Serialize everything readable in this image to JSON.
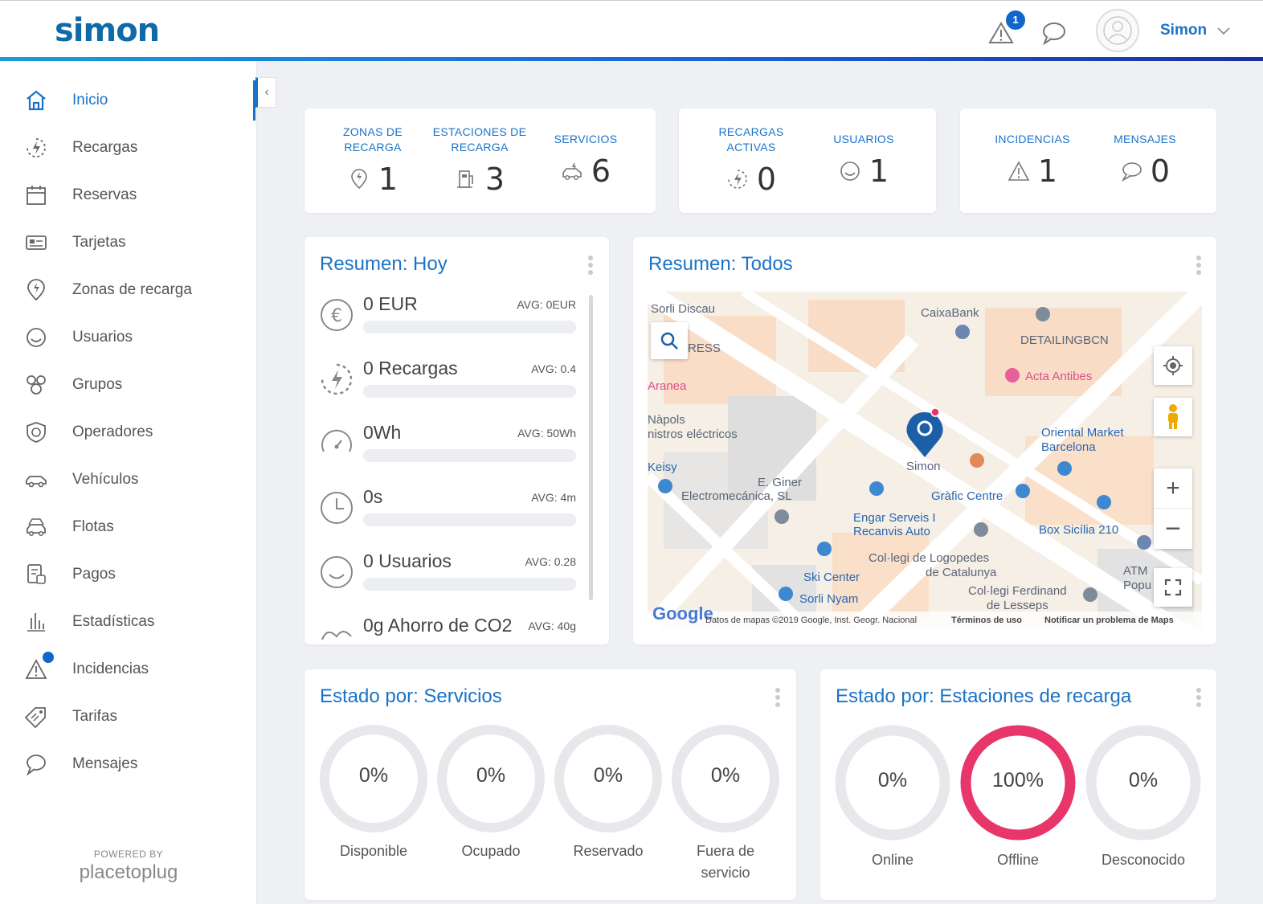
{
  "header": {
    "logo": "simon",
    "alert_count": "1",
    "user_name": "Simon"
  },
  "sidebar": {
    "items": [
      {
        "label": "Inicio",
        "icon": "home-icon",
        "active": true
      },
      {
        "label": "Recargas",
        "icon": "charge-icon"
      },
      {
        "label": "Reservas",
        "icon": "calendar-icon"
      },
      {
        "label": "Tarjetas",
        "icon": "card-icon"
      },
      {
        "label": "Zonas de recarga",
        "icon": "charge-zone-icon"
      },
      {
        "label": "Usuarios",
        "icon": "user-smile-icon"
      },
      {
        "label": "Grupos",
        "icon": "groups-icon"
      },
      {
        "label": "Operadores",
        "icon": "shield-icon"
      },
      {
        "label": "Vehículos",
        "icon": "car-icon"
      },
      {
        "label": "Flotas",
        "icon": "fleet-icon"
      },
      {
        "label": "Pagos",
        "icon": "payments-icon"
      },
      {
        "label": "Estadísticas",
        "icon": "stats-icon"
      },
      {
        "label": "Incidencias",
        "icon": "warning-icon"
      },
      {
        "label": "Tarifas",
        "icon": "tag-icon"
      },
      {
        "label": "Mensajes",
        "icon": "chat-icon"
      }
    ],
    "powered_by": "POWERED BY",
    "partner": "placetoplug"
  },
  "stats": {
    "zonas": {
      "head1": "ZONAS DE",
      "head2": "RECARGA",
      "value": "1"
    },
    "estaciones": {
      "head1": "ESTACIONES DE",
      "head2": "RECARGA",
      "value": "3"
    },
    "servicios": {
      "head1": "SERVICIOS",
      "value": "6"
    },
    "recargas": {
      "head1": "RECARGAS",
      "head2": "ACTIVAS",
      "value": "0"
    },
    "usuarios": {
      "head1": "USUARIOS",
      "value": "1"
    },
    "incidencias": {
      "head1": "INCIDENCIAS",
      "value": "1"
    },
    "mensajes": {
      "head1": "MENSAJES",
      "value": "0"
    }
  },
  "resumen_hoy": {
    "title": "Resumen: Hoy",
    "metrics": [
      {
        "value": "0 EUR",
        "avg": "AVG: 0EUR",
        "icon": "euro-icon"
      },
      {
        "value": "0 Recargas",
        "avg": "AVG: 0.4",
        "icon": "charge-icon"
      },
      {
        "value": "0Wh",
        "avg": "AVG: 50Wh",
        "icon": "gauge-icon"
      },
      {
        "value": "0s",
        "avg": "AVG: 4m",
        "icon": "clock-icon"
      },
      {
        "value": "0 Usuarios",
        "avg": "AVG: 0.28",
        "icon": "user-smile-icon"
      },
      {
        "value": "0g Ahorro de CO2",
        "avg": "AVG: 40g",
        "icon": "leaf-icon"
      }
    ]
  },
  "resumen_todos": {
    "title": "Resumen: Todos",
    "map_labels": {
      "sorli": "Sorli Discau",
      "caixa": "CaixaBank",
      "detailing": "DETAILINGBCN",
      "ress": "RESS",
      "acta": "Acta Antibes",
      "aranea": "Aranea",
      "napols1": "Nàpols",
      "napols2": "nistros eléctricos",
      "oriental1": "Oriental Market",
      "oriental2": "Barcelona",
      "keisy": "Keisy",
      "simon": "Simon",
      "giner1": "E. Giner",
      "giner2": "Electromecánica, SL",
      "grafic": "Gràfic Centre",
      "engar1": "Engar Serveis I",
      "engar2": "Recanvis Auto",
      "box": "Box Sicília 210",
      "logo1": "Col·legi de Logopedes",
      "logo2": "de Catalunya",
      "atm1": "ATM",
      "atm2": "Popu",
      "ski": "Ski Center",
      "sorlin": "Sorli Nyam",
      "ferd1": "Col·legi Ferdinand",
      "ferd2": "de Lesseps",
      "google": "Google",
      "attrib": "Datos de mapas ©2019 Google, Inst. Geogr. Nacional",
      "terms": "Términos de uso",
      "report": "Notificar un problema de Maps"
    }
  },
  "estado_servicios": {
    "title": "Estado por: Servicios",
    "items": [
      {
        "pct": "0%",
        "label1": "Disponible",
        "label2": ""
      },
      {
        "pct": "0%",
        "label1": "Ocupado",
        "label2": ""
      },
      {
        "pct": "0%",
        "label1": "Reservado",
        "label2": ""
      },
      {
        "pct": "0%",
        "label1": "Fuera de",
        "label2": "servicio"
      }
    ]
  },
  "estado_estaciones": {
    "title": "Estado por: Estaciones de recarga",
    "items": [
      {
        "pct": "0%",
        "label": "Online"
      },
      {
        "pct": "100%",
        "label": "Offline"
      },
      {
        "pct": "0%",
        "label": "Desconocido"
      }
    ]
  },
  "colors": {
    "accent": "#1a73c8",
    "offline": "#e8366b",
    "ring": "#e6e8eb"
  }
}
